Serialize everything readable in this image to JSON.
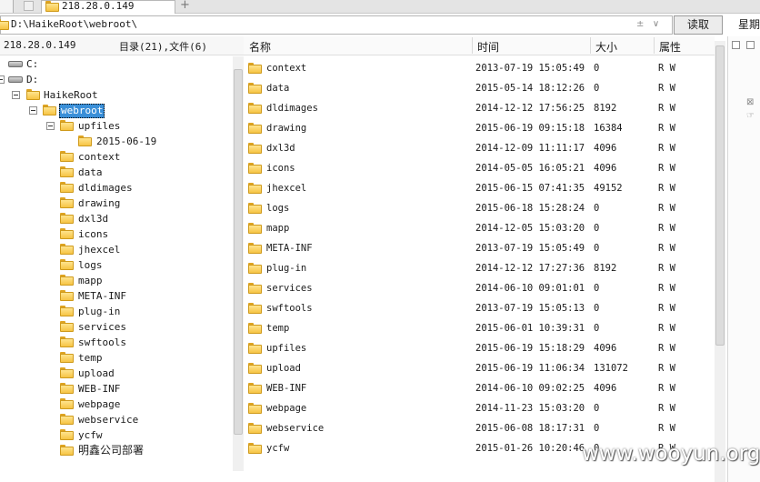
{
  "tabs": [
    {
      "label": "218.28.0.149",
      "active": true
    }
  ],
  "tab_add_label": "+",
  "address_bar": {
    "path": "D:\\HaikeRoot\\webroot\\",
    "button_label": "读取",
    "right_tab_label": "星期"
  },
  "left_panel": {
    "host": "218.28.0.149",
    "count_label": "目录(21),文件(6)",
    "tree": [
      {
        "label": "C:",
        "type": "drive"
      },
      {
        "label": "D:",
        "type": "drive"
      },
      {
        "label": "HaikeRoot",
        "type": "folder"
      },
      {
        "label": "webroot",
        "type": "folder",
        "selected": true
      },
      {
        "label": "upfiles",
        "type": "folder"
      },
      {
        "label": "2015-06-19",
        "type": "folder"
      },
      {
        "label": "context",
        "type": "folder"
      },
      {
        "label": "data",
        "type": "folder"
      },
      {
        "label": "dldimages",
        "type": "folder"
      },
      {
        "label": "drawing",
        "type": "folder"
      },
      {
        "label": "dxl3d",
        "type": "folder"
      },
      {
        "label": "icons",
        "type": "folder"
      },
      {
        "label": "jhexcel",
        "type": "folder"
      },
      {
        "label": "logs",
        "type": "folder"
      },
      {
        "label": "mapp",
        "type": "folder"
      },
      {
        "label": "META-INF",
        "type": "folder"
      },
      {
        "label": "plug-in",
        "type": "folder"
      },
      {
        "label": "services",
        "type": "folder"
      },
      {
        "label": "swftools",
        "type": "folder"
      },
      {
        "label": "temp",
        "type": "folder"
      },
      {
        "label": "upload",
        "type": "folder"
      },
      {
        "label": "WEB-INF",
        "type": "folder"
      },
      {
        "label": "webpage",
        "type": "folder"
      },
      {
        "label": "webservice",
        "type": "folder"
      },
      {
        "label": "ycfw",
        "type": "folder"
      },
      {
        "label": "明鑫公司部署",
        "type": "folder"
      }
    ]
  },
  "file_list": {
    "columns": [
      "名称",
      "时间",
      "大小",
      "属性"
    ],
    "rows": [
      {
        "name": "context",
        "time": "2013-07-19 15:05:49",
        "size": "0",
        "attr": "R W"
      },
      {
        "name": "data",
        "time": "2015-05-14 18:12:26",
        "size": "0",
        "attr": "R W"
      },
      {
        "name": "dldimages",
        "time": "2014-12-12 17:56:25",
        "size": "8192",
        "attr": "R W"
      },
      {
        "name": "drawing",
        "time": "2015-06-19 09:15:18",
        "size": "16384",
        "attr": "R W"
      },
      {
        "name": "dxl3d",
        "time": "2014-12-09 11:11:17",
        "size": "4096",
        "attr": "R W"
      },
      {
        "name": "icons",
        "time": "2014-05-05 16:05:21",
        "size": "4096",
        "attr": "R W"
      },
      {
        "name": "jhexcel",
        "time": "2015-06-15 07:41:35",
        "size": "49152",
        "attr": "R W"
      },
      {
        "name": "logs",
        "time": "2015-06-18 15:28:24",
        "size": "0",
        "attr": "R W"
      },
      {
        "name": "mapp",
        "time": "2014-12-05 15:03:20",
        "size": "0",
        "attr": "R W"
      },
      {
        "name": "META-INF",
        "time": "2013-07-19 15:05:49",
        "size": "0",
        "attr": "R W"
      },
      {
        "name": "plug-in",
        "time": "2014-12-12 17:27:36",
        "size": "8192",
        "attr": "R W"
      },
      {
        "name": "services",
        "time": "2014-06-10 09:01:01",
        "size": "0",
        "attr": "R W"
      },
      {
        "name": "swftools",
        "time": "2013-07-19 15:05:13",
        "size": "0",
        "attr": "R W"
      },
      {
        "name": "temp",
        "time": "2015-06-01 10:39:31",
        "size": "0",
        "attr": "R W"
      },
      {
        "name": "upfiles",
        "time": "2015-06-19 15:18:29",
        "size": "4096",
        "attr": "R W"
      },
      {
        "name": "upload",
        "time": "2015-06-19 11:06:34",
        "size": "131072",
        "attr": "R W"
      },
      {
        "name": "WEB-INF",
        "time": "2014-06-10 09:02:25",
        "size": "4096",
        "attr": "R W"
      },
      {
        "name": "webpage",
        "time": "2014-11-23 15:03:20",
        "size": "0",
        "attr": "R W"
      },
      {
        "name": "webservice",
        "time": "2015-06-08 18:17:31",
        "size": "0",
        "attr": "R W"
      },
      {
        "name": "ycfw",
        "time": "2015-01-26 10:20:46",
        "size": "0",
        "attr": "R W"
      }
    ]
  },
  "watermark": "www.wooyun.org",
  "colors": {
    "selection": "#3a8fd8",
    "folder": "#f6c444"
  }
}
